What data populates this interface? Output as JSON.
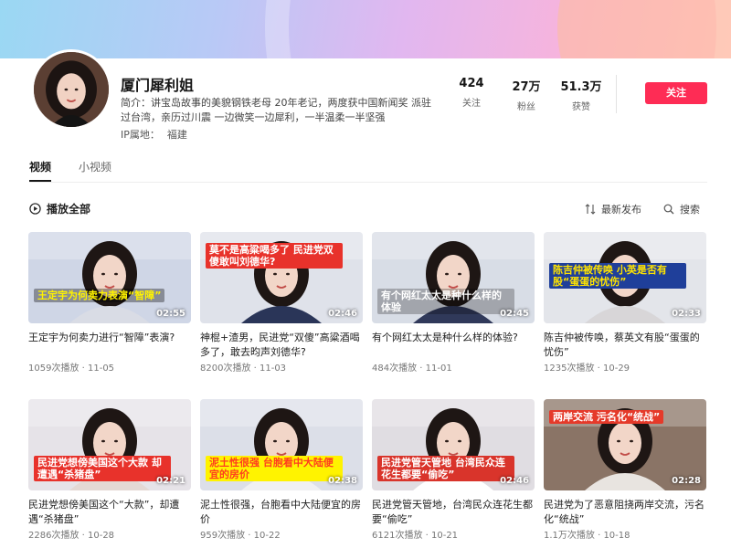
{
  "profile": {
    "name": "厦门犀利姐",
    "bio_line1": "简介：讲宝岛故事的美貌钢铁老母 20年老记，两度获中国新闻奖 派驻",
    "bio_line2": "过台湾，亲历过川震 一边微笑一边犀利，一半温柔一半坚强",
    "ip_label": "IP属地：",
    "ip_value": "福建"
  },
  "stats": [
    {
      "value": "424",
      "label": "关注"
    },
    {
      "value": "27万",
      "label": "粉丝"
    },
    {
      "value": "51.3万",
      "label": "获赞"
    }
  ],
  "follow_label": "关注",
  "tabs": [
    "视频",
    "小视频"
  ],
  "toolbar": {
    "play_all": "播放全部",
    "sort": "最新发布",
    "search": "搜索"
  },
  "videos": [
    {
      "title": "王定宇为何卖力进行“智障”表演?",
      "views": "1059次播放 · 11-05",
      "duration": "02:55",
      "caption": "王定宇为何卖力表演“智障”",
      "cap_color": "#fff300",
      "cap_bg": "rgba(0,0,0,0.35)",
      "cap_pos": "bottom",
      "bg": "#cfd6e6",
      "sweater": "#d9dce5"
    },
    {
      "title": "神棍+渣男，民进党“双傻”高粱酒喝多了，敢去昀声刘德华?",
      "views": "8200次播放 · 11-03",
      "duration": "02:46",
      "caption": "莫不是高粱喝多了 民进党双傻敢叫刘德华?",
      "cap_color": "#ffffff",
      "cap_bg": "#e8322b",
      "cap_pos": "top",
      "bg": "#dfe2ea",
      "sweater": "#2a3558"
    },
    {
      "title": "有个网红太太是种什么样的体验?",
      "views": "484次播放 · 11-01",
      "duration": "02:45",
      "caption": "有个网红太太是种什么样的体验",
      "cap_color": "#ffffff",
      "cap_bg": "rgba(0,0,0,0.25)",
      "cap_pos": "bottom",
      "bg": "#d8dde6",
      "sweater": "#30395a"
    },
    {
      "title": "陈吉仲被传唤，蔡英文有股“蛋蛋的忧伤”",
      "views": "1235次播放 · 10-29",
      "duration": "02:33",
      "caption": "陈吉仲被传唤 小英是否有股“蛋蛋的忧伤”",
      "cap_color": "#ffe400",
      "cap_bg": "#1f3f9a",
      "cap_pos": "mid",
      "bg": "#e3e5ea",
      "sweater": "#d8d6d8"
    },
    {
      "title": "民进党想傍美国这个“大款”，却遭遇“杀猪盘”",
      "views": "2286次播放 · 10-28",
      "duration": "02:21",
      "caption": "民进党想傍美国这个大款 却遭遇“杀猪盘”",
      "cap_color": "#ffffff",
      "cap_bg": "#e8322b",
      "cap_pos": "bottom",
      "bg": "#e6e3e8",
      "sweater": "#e4d8d4"
    },
    {
      "title": "泥土性很强，台胞看中大陆便宜的房价",
      "views": "959次播放 · 10-22",
      "duration": "02:38",
      "caption": "泥土性很强 台胞看中大陆便宜的房价",
      "cap_color": "#ff3b1f",
      "cap_bg": "#fff300",
      "cap_pos": "bottom",
      "bg": "#dcdfe8",
      "sweater": "#f0f0f2"
    },
    {
      "title": "民进党管天管地，台湾民众连花生都要“偷吃”",
      "views": "6121次播放 · 10-21",
      "duration": "02:46",
      "caption": "民进党管天管地 台湾民众连花生都要“偷吃”",
      "cap_color": "#ffffff",
      "cap_bg": "#d9342b",
      "cap_pos": "bottom",
      "bg": "#e0dde2",
      "sweater": "#ffffff"
    },
    {
      "title": "民进党为了恶意阻挠两岸交流，污名化“统战”",
      "views": "1.1万次播放 · 10-18",
      "duration": "02:28",
      "caption": "两岸交流 污名化“统战”",
      "cap_color": "#ffffff",
      "cap_bg": "#e53a2a",
      "cap_pos": "top",
      "bg": "#8a7466",
      "sweater": "#e8e4e0"
    }
  ]
}
